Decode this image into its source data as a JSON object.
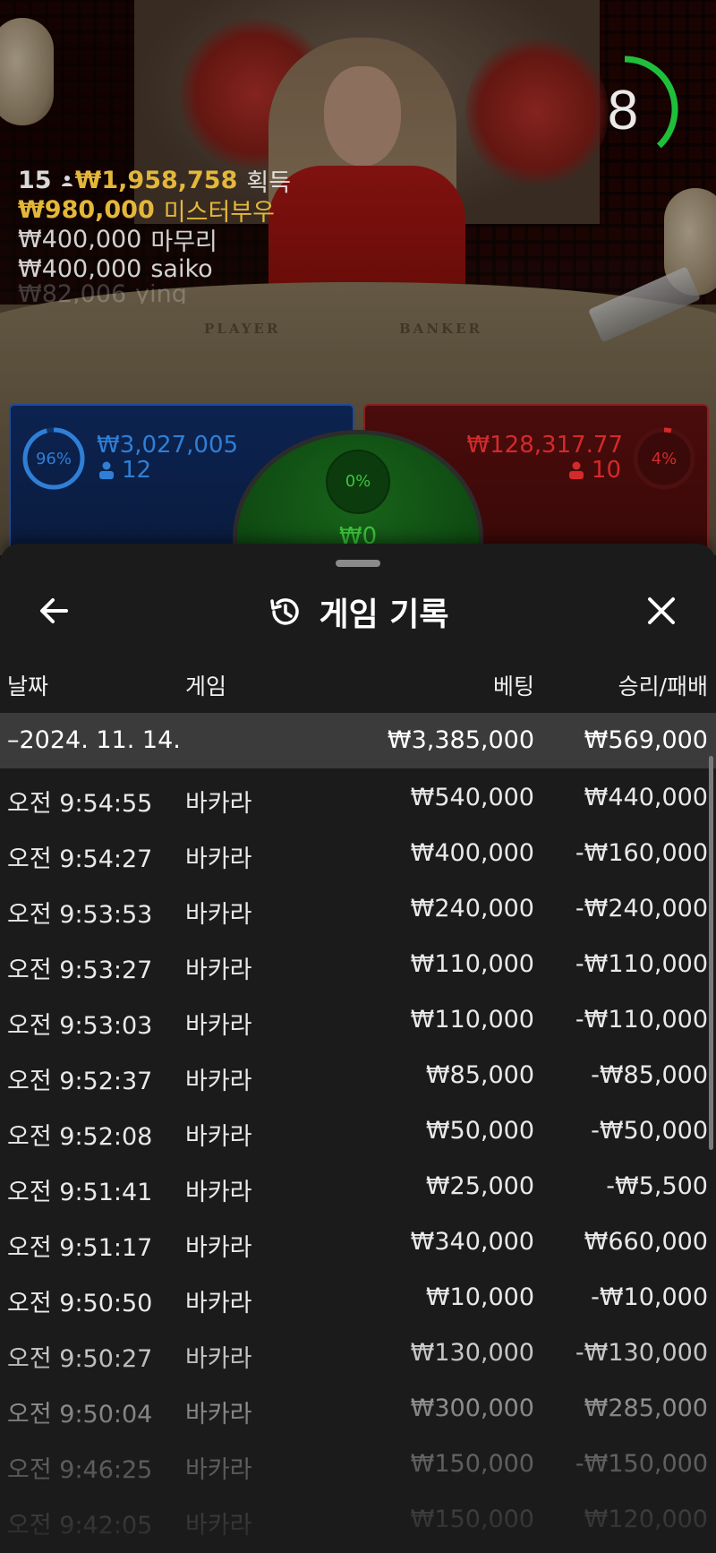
{
  "timer": {
    "seconds": "8",
    "color": "#1fbf3a",
    "progress": 0.38
  },
  "table": {
    "player_label": "PLAYER",
    "banker_label": "BANKER"
  },
  "winners": {
    "round_count": "15",
    "total_won": "₩1,958,758",
    "total_suffix": "획득",
    "list": [
      {
        "amount": "₩980,000",
        "name": "미스터부우",
        "style": "top"
      },
      {
        "amount": "₩400,000",
        "name": "마무리",
        "style": "dim"
      },
      {
        "amount": "₩400,000",
        "name": "saiko",
        "style": "dim"
      },
      {
        "amount": "₩82,006",
        "name": "ying",
        "style": "fade"
      }
    ]
  },
  "bets": {
    "player": {
      "percent": "96%",
      "percent_value": 96,
      "amount": "₩3,027,005",
      "players": "12",
      "color": "#2f7fd6"
    },
    "tie": {
      "percent": "0%",
      "amount": "₩0",
      "color": "#3cc43c"
    },
    "banker": {
      "percent": "4%",
      "percent_value": 4,
      "amount": "₩128,317.77",
      "players": "10",
      "color": "#d42a2a"
    }
  },
  "sheet": {
    "title": "게임 기록",
    "back_icon": "arrow-left-icon",
    "history_icon": "history-icon",
    "close_icon": "close-icon",
    "columns": {
      "date": "날짜",
      "game": "게임",
      "bet": "베팅",
      "winloss": "승리/패배"
    },
    "day": {
      "date": "–2024. 11. 14.",
      "bet": "₩3,385,000",
      "winloss": "₩569,000"
    },
    "rows": [
      {
        "time": "오전 9:54:55",
        "game": "바카라",
        "bet": "₩540,000",
        "winloss": "₩440,000"
      },
      {
        "time": "오전 9:54:27",
        "game": "바카라",
        "bet": "₩400,000",
        "winloss": "-₩160,000"
      },
      {
        "time": "오전 9:53:53",
        "game": "바카라",
        "bet": "₩240,000",
        "winloss": "-₩240,000"
      },
      {
        "time": "오전 9:53:27",
        "game": "바카라",
        "bet": "₩110,000",
        "winloss": "-₩110,000"
      },
      {
        "time": "오전 9:53:03",
        "game": "바카라",
        "bet": "₩110,000",
        "winloss": "-₩110,000"
      },
      {
        "time": "오전 9:52:37",
        "game": "바카라",
        "bet": "₩85,000",
        "winloss": "-₩85,000"
      },
      {
        "time": "오전 9:52:08",
        "game": "바카라",
        "bet": "₩50,000",
        "winloss": "-₩50,000"
      },
      {
        "time": "오전 9:51:41",
        "game": "바카라",
        "bet": "₩25,000",
        "winloss": "-₩5,500"
      },
      {
        "time": "오전 9:51:17",
        "game": "바카라",
        "bet": "₩340,000",
        "winloss": "₩660,000"
      },
      {
        "time": "오전 9:50:50",
        "game": "바카라",
        "bet": "₩10,000",
        "winloss": "-₩10,000"
      },
      {
        "time": "오전 9:50:27",
        "game": "바카라",
        "bet": "₩130,000",
        "winloss": "-₩130,000"
      },
      {
        "time": "오전 9:50:04",
        "game": "바카라",
        "bet": "₩300,000",
        "winloss": "₩285,000"
      },
      {
        "time": "오전 9:46:25",
        "game": "바카라",
        "bet": "₩150,000",
        "winloss": "-₩150,000"
      },
      {
        "time": "오전 9:42:05",
        "game": "바카라",
        "bet": "₩150,000",
        "winloss": "₩120,000"
      }
    ]
  }
}
